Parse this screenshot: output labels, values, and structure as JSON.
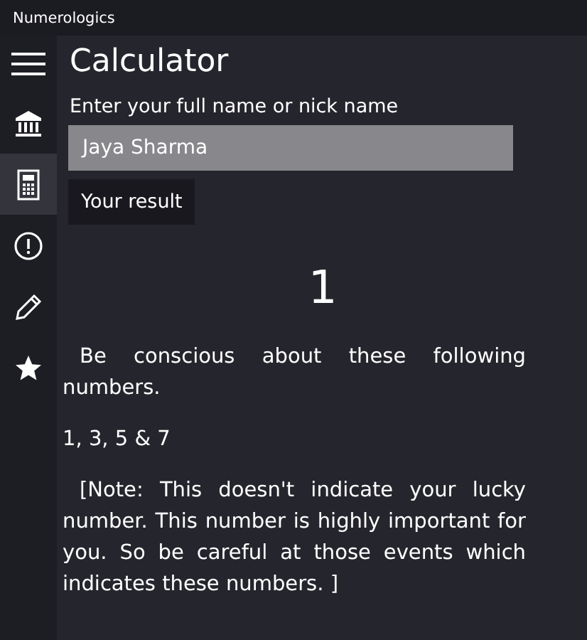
{
  "window": {
    "title": "Numerologics"
  },
  "nav": [
    {
      "kind": "menu",
      "selected": false
    },
    {
      "kind": "bank",
      "selected": false
    },
    {
      "kind": "calculator",
      "selected": true
    },
    {
      "kind": "info",
      "selected": false
    },
    {
      "kind": "pencil",
      "selected": false
    },
    {
      "kind": "star",
      "selected": false
    }
  ],
  "page_title": "Calculator",
  "name_field": {
    "label": "Enter your full name or nick name",
    "value": "Jaya Sharma"
  },
  "result_button": "Your result",
  "result": "1",
  "message": "Be conscious about these following numbers.",
  "numbers": "1, 3, 5 & 7",
  "note": "[Note: This doesn't indicate your lucky number. This number is highly important for you. So be careful at those events which indicates these numbers. ]"
}
